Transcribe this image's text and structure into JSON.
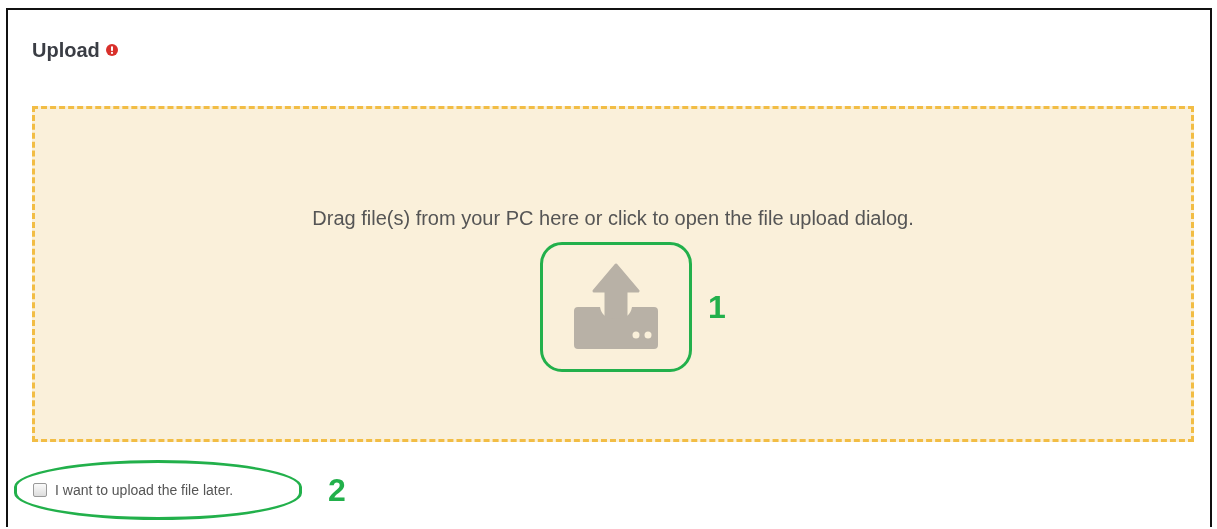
{
  "section": {
    "title": "Upload",
    "required": true
  },
  "dropzone": {
    "message": "Drag file(s) from your PC here or click to open the file upload dialog."
  },
  "upload_later": {
    "label": "I want to upload the file later.",
    "checked": false
  },
  "callouts": [
    {
      "label": "1"
    },
    {
      "label": "2"
    }
  ]
}
